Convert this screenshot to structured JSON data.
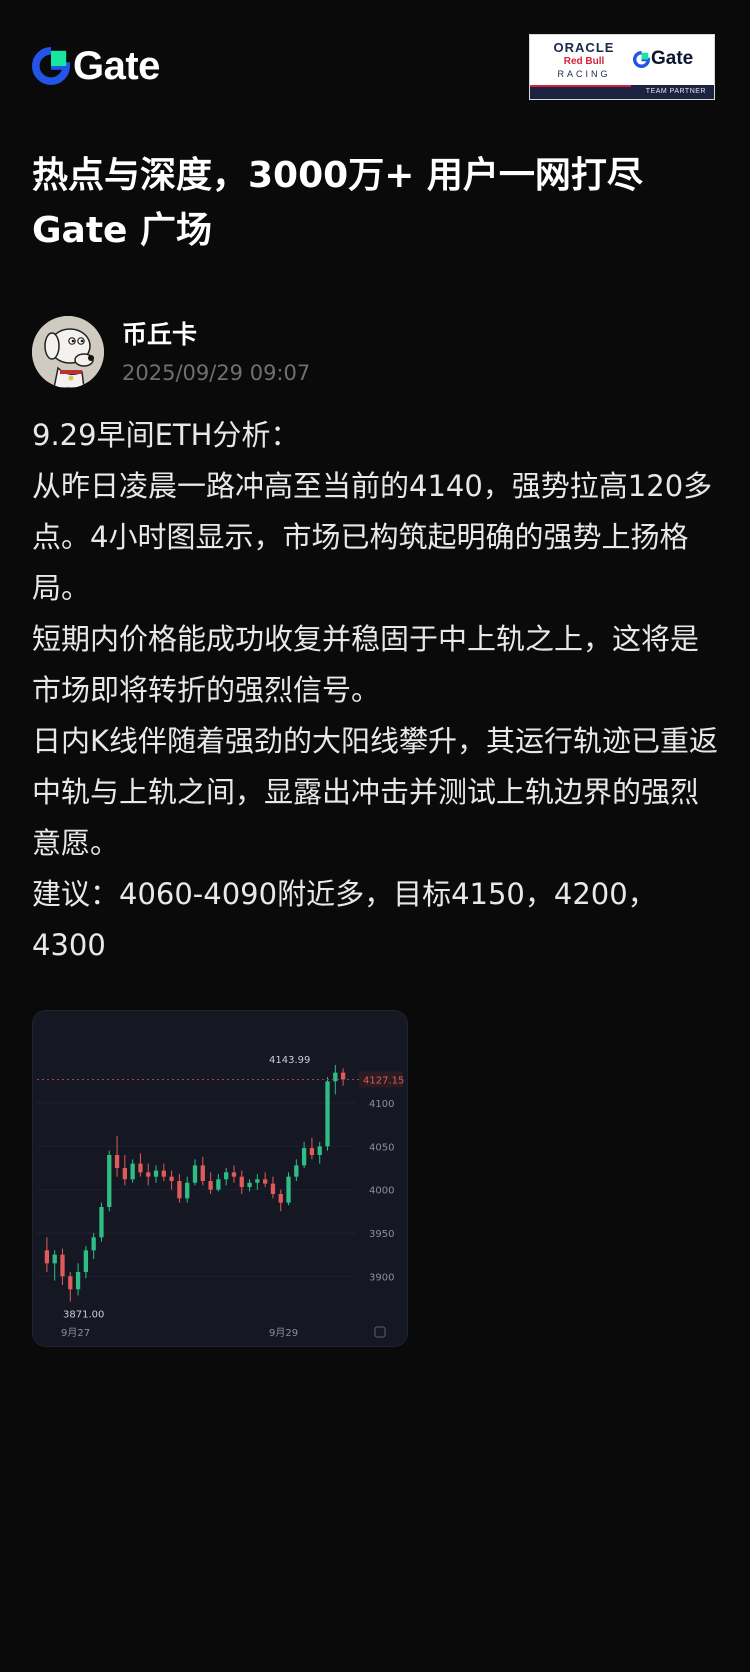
{
  "header": {
    "brand": "Gate",
    "partner": {
      "oracle": "ORACLE",
      "redbull": "Red Bull",
      "racing": "RACING",
      "brand": "Gate",
      "tagline": "TEAM PARTNER"
    }
  },
  "headline": "热点与深度，3000万+ 用户一网打尽 Gate 广场",
  "author": {
    "name": "币丘卡",
    "timestamp": "2025/09/29 09:07"
  },
  "post": {
    "lines": [
      "9.29早间ETH分析：",
      "从昨日凌晨一路冲高至当前的4140，强势拉高120多点。4小时图显示，市场已构筑起明确的强势上扬格局。",
      "短期内价格能成功收复并稳固于中上轨之上，这将是市场即将转折的强烈信号。",
      "日内K线伴随着强劲的大阳线攀升，其运行轨迹已重返中轨与上轨之间，显露出冲击并测试上轨边界的强烈意愿。",
      "建议：4060-4090附近多，目标4150，4200，4300"
    ]
  },
  "chart_data": {
    "type": "candlestick",
    "y_ticks": [
      3900,
      3950,
      4000,
      4050,
      4100
    ],
    "ylim": [
      3860,
      4160
    ],
    "x_labels": [
      "9月27",
      "9月29"
    ],
    "high_label": "4143.99",
    "low_label": "3871.00",
    "current_price": "4127.15",
    "colors": {
      "up": "#2ebd85",
      "down": "#e05a5a",
      "current": "#e05a5a",
      "background": "#151822"
    },
    "candles": [
      {
        "o": 3930,
        "h": 3945,
        "l": 3905,
        "c": 3915
      },
      {
        "o": 3915,
        "h": 3930,
        "l": 3895,
        "c": 3925
      },
      {
        "o": 3925,
        "h": 3932,
        "l": 3890,
        "c": 3900
      },
      {
        "o": 3900,
        "h": 3905,
        "l": 3871,
        "c": 3885
      },
      {
        "o": 3885,
        "h": 3915,
        "l": 3878,
        "c": 3905
      },
      {
        "o": 3905,
        "h": 3935,
        "l": 3898,
        "c": 3930
      },
      {
        "o": 3930,
        "h": 3950,
        "l": 3920,
        "c": 3945
      },
      {
        "o": 3945,
        "h": 3985,
        "l": 3940,
        "c": 3980
      },
      {
        "o": 3980,
        "h": 4045,
        "l": 3975,
        "c": 4040
      },
      {
        "o": 4040,
        "h": 4062,
        "l": 4015,
        "c": 4025
      },
      {
        "o": 4025,
        "h": 4040,
        "l": 4005,
        "c": 4012
      },
      {
        "o": 4012,
        "h": 4035,
        "l": 4008,
        "c": 4030
      },
      {
        "o": 4030,
        "h": 4042,
        "l": 4015,
        "c": 4020
      },
      {
        "o": 4020,
        "h": 4030,
        "l": 4005,
        "c": 4015
      },
      {
        "o": 4015,
        "h": 4028,
        "l": 4008,
        "c": 4022
      },
      {
        "o": 4022,
        "h": 4030,
        "l": 4010,
        "c": 4015
      },
      {
        "o": 4015,
        "h": 4022,
        "l": 4000,
        "c": 4010
      },
      {
        "o": 4010,
        "h": 4018,
        "l": 3985,
        "c": 3990
      },
      {
        "o": 3990,
        "h": 4015,
        "l": 3985,
        "c": 4008
      },
      {
        "o": 4008,
        "h": 4035,
        "l": 4005,
        "c": 4028
      },
      {
        "o": 4028,
        "h": 4038,
        "l": 4005,
        "c": 4010
      },
      {
        "o": 4010,
        "h": 4020,
        "l": 3995,
        "c": 4000
      },
      {
        "o": 4000,
        "h": 4018,
        "l": 3998,
        "c": 4012
      },
      {
        "o": 4012,
        "h": 4025,
        "l": 4005,
        "c": 4020
      },
      {
        "o": 4020,
        "h": 4028,
        "l": 4008,
        "c": 4015
      },
      {
        "o": 4015,
        "h": 4022,
        "l": 3995,
        "c": 4003
      },
      {
        "o": 4003,
        "h": 4012,
        "l": 3998,
        "c": 4008
      },
      {
        "o": 4008,
        "h": 4018,
        "l": 4000,
        "c": 4012
      },
      {
        "o": 4012,
        "h": 4020,
        "l": 4003,
        "c": 4007
      },
      {
        "o": 4007,
        "h": 4015,
        "l": 3990,
        "c": 3995
      },
      {
        "o": 3995,
        "h": 4000,
        "l": 3975,
        "c": 3985
      },
      {
        "o": 3985,
        "h": 4020,
        "l": 3982,
        "c": 4015
      },
      {
        "o": 4015,
        "h": 4035,
        "l": 4010,
        "c": 4028
      },
      {
        "o": 4028,
        "h": 4055,
        "l": 4025,
        "c": 4048
      },
      {
        "o": 4048,
        "h": 4060,
        "l": 4035,
        "c": 4040
      },
      {
        "o": 4040,
        "h": 4055,
        "l": 4030,
        "c": 4050
      },
      {
        "o": 4050,
        "h": 4130,
        "l": 4045,
        "c": 4125
      },
      {
        "o": 4125,
        "h": 4143.99,
        "l": 4110,
        "c": 4135
      },
      {
        "o": 4135,
        "h": 4140,
        "l": 4120,
        "c": 4127.15
      }
    ]
  }
}
